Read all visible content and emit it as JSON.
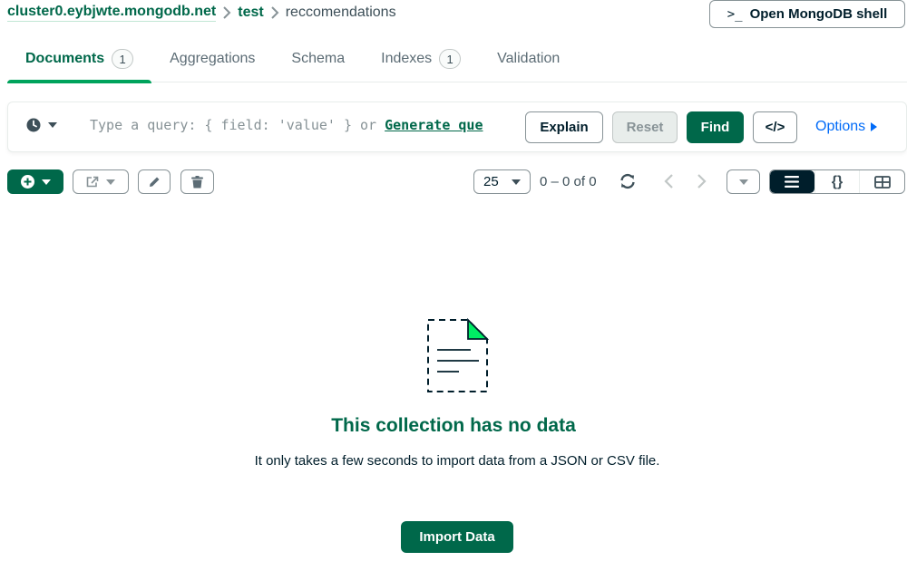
{
  "breadcrumb": {
    "cluster": "cluster0.eybjwte.mongodb.net",
    "database": "test",
    "collection": "reccomendations"
  },
  "header": {
    "shell_button": "Open MongoDB shell",
    "shell_prompt": ">_"
  },
  "tabs": [
    {
      "label": "Documents",
      "count": "1"
    },
    {
      "label": "Aggregations"
    },
    {
      "label": "Schema"
    },
    {
      "label": "Indexes",
      "count": "1"
    },
    {
      "label": "Validation"
    }
  ],
  "query": {
    "placeholder": "Type a query: { field: 'value' } or ",
    "generate_link": "Generate que",
    "explain": "Explain",
    "reset": "Reset",
    "find": "Find",
    "code": "</>",
    "options": "Options"
  },
  "toolbar": {
    "page_size": "25",
    "range": "0 – 0 of 0"
  },
  "views": {
    "list": "☰",
    "json": "{}",
    "table": "▦"
  },
  "empty": {
    "title": "This collection has no data",
    "text": "It only takes a few seconds to import data from a JSON or CSV file.",
    "import_button": "Import Data"
  },
  "colors": {
    "brand": "#00684a",
    "accent": "#00a35c",
    "link": "#016bf8",
    "dark": "#001e2b"
  }
}
